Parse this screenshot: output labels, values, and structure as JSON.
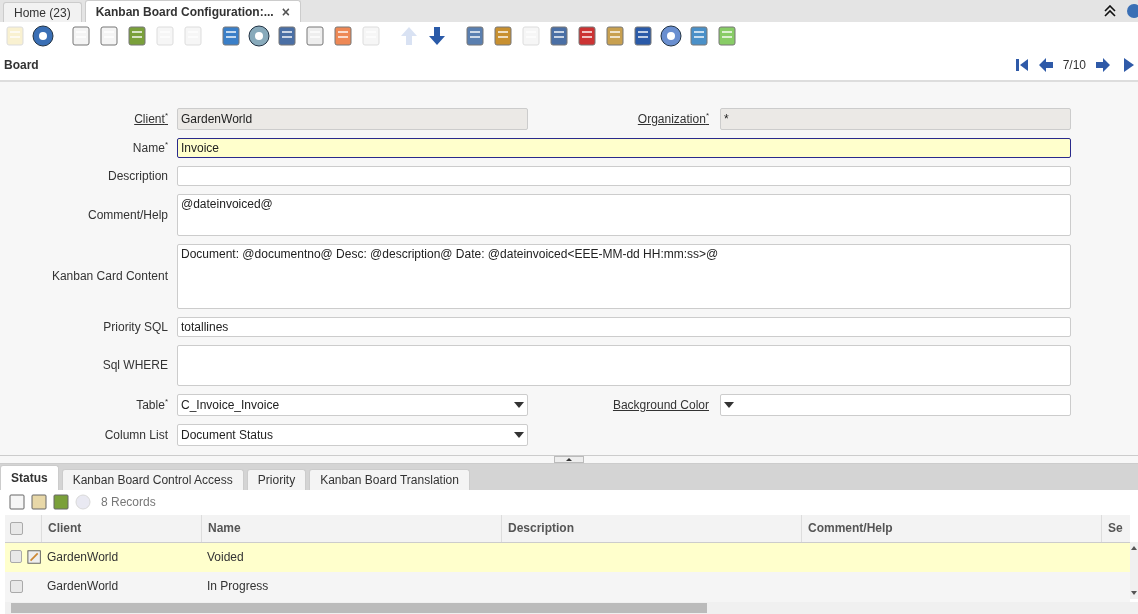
{
  "window_tabs": [
    {
      "label": "Home (23)",
      "selected": false
    },
    {
      "label": "Kanban Board Configuration:...",
      "selected": true,
      "close": "×"
    }
  ],
  "toolbar": [
    {
      "disabled": true
    },
    {
      "disabled": false
    },
    {
      "disabled": false
    },
    {
      "disabled": false
    },
    {
      "disabled": false
    },
    {
      "disabled": true
    },
    {
      "disabled": true
    },
    {
      "disabled": false
    },
    {
      "disabled": false
    },
    {
      "disabled": false
    },
    {
      "disabled": false
    },
    {
      "disabled": false
    },
    {
      "disabled": true
    },
    {
      "disabled": true
    },
    {
      "disabled": false
    },
    {
      "disabled": false
    },
    {
      "disabled": false
    },
    {
      "disabled": true
    },
    {
      "disabled": false
    },
    {
      "disabled": false
    },
    {
      "disabled": false
    },
    {
      "disabled": false
    },
    {
      "disabled": false
    },
    {
      "disabled": false
    },
    {
      "disabled": false
    }
  ],
  "header": {
    "title": "Board",
    "record": "7/10"
  },
  "form_rows": [
    {
      "fields": [
        {
          "label": "Client$^{*}$",
          "link": true,
          "kind": "text",
          "value": "GardenWorld",
          "readonly": true,
          "focused": false
        },
        {
          "label": "Organization$^{*}$",
          "link": true,
          "kind": "text",
          "value": "*",
          "readonly": true,
          "focused": false
        }
      ]
    },
    {
      "fields": [
        {
          "label": "Name$^{*}$",
          "link": false,
          "kind": "text",
          "value": "Invoice",
          "readonly": false,
          "focused": true
        }
      ]
    },
    {
      "fields": [
        {
          "label": "Description",
          "link": false,
          "kind": "text",
          "readonly": false,
          "focused": false
        }
      ]
    },
    {
      "fields": [
        {
          "label": "Comment/Help",
          "link": false,
          "kind": "textarea",
          "value": "@dateinvoiced@"
        }
      ]
    },
    {
      "fields": [
        {
          "label": "Kanban Card Content",
          "link": false,
          "kind": "textarea",
          "value": "Document: @documentno@ Desc: @description@ Date: @dateinvoiced<EEE-MM-dd HH:mm:ss>@"
        }
      ]
    },
    {
      "fields": [
        {
          "label": "Priority SQL",
          "link": false,
          "kind": "text",
          "value": "totallines",
          "readonly": false,
          "focused": false
        }
      ]
    },
    {
      "fields": [
        {
          "label": "Sql WHERE",
          "link": false,
          "kind": "textarea"
        }
      ]
    },
    {
      "fields": [
        {
          "label": "Table$^{*}$",
          "link": false,
          "kind": "select",
          "value": "C_Invoice_Invoice"
        },
        {
          "label": "Background Color",
          "link": true,
          "kind": "select"
        }
      ]
    },
    {
      "fields": [
        {
          "label": "Column List",
          "link": false,
          "kind": "select",
          "value": "Document Status"
        }
      ]
    }
  ],
  "detail_tabs": [
    {
      "label": "Status",
      "selected": true
    },
    {
      "label": "Kanban Board Control Access",
      "selected": false
    },
    {
      "label": "Priority",
      "selected": false
    },
    {
      "label": "Kanban Board Translation",
      "selected": false
    }
  ],
  "detail_toolbar": {
    "buttons": [
      {
        "disabled": false
      },
      {
        "disabled": false
      },
      {
        "disabled": false
      },
      {
        "disabled": true
      }
    ],
    "count": "8 Records"
  },
  "grid": {
    "header_checked": false,
    "columns": [
      "Client",
      "Name",
      "Description",
      "Comment/Help",
      "Se"
    ],
    "rows": [
      {
        "cells": [
          "GardenWorld",
          "Voided",
          "",
          ""
        ],
        "checked": false,
        "selected": true
      },
      {
        "cells": [
          "GardenWorld",
          "In Progress",
          "",
          ""
        ],
        "checked": false,
        "selected": false
      }
    ]
  }
}
